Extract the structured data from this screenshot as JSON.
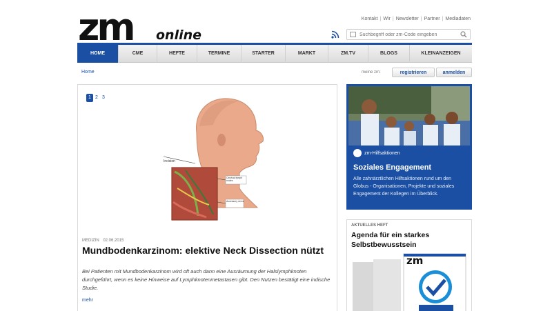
{
  "logo": {
    "zm": "zm",
    "online": "online"
  },
  "toplinks": [
    "Kontakt",
    "Wir",
    "Newsletter",
    "Partner",
    "Mediadaten"
  ],
  "search": {
    "placeholder": "Suchbegriff oder zm-Code eingeben"
  },
  "nav": {
    "items": [
      "HOME",
      "CME",
      "HEFTE",
      "TERMINE",
      "STARTER",
      "MARKT",
      "ZM.TV",
      "BLOGS",
      "KLEINANZEIGEN"
    ],
    "active": "HOME"
  },
  "breadcrumb": "Home",
  "account": {
    "meinzm": "meine zm:",
    "register": "registrieren",
    "login": "anmelden"
  },
  "article": {
    "pager": [
      "1",
      "2",
      "3"
    ],
    "category": "MEDIZIN",
    "date": "02.06.2015",
    "headline": "Mundbodenkarzinom: elektive Neck Dissection nützt",
    "teaser": "Bei Patienten mit Mundbodenkarzinom wird oft auch dann eine Ausräumung der Halslymphknoten durchgeführt, wenn es keine Hinweise auf Lymphknotenmetastasen gibt. Den Nutzen bestätigt eine indische Studie.",
    "more": "mehr",
    "illustration_labels": {
      "incision": "Incision",
      "lymph": "Cervical lymph nodes",
      "accessory": "Accessory nerve"
    }
  },
  "promo": {
    "brand": "zm-Hilfsaktionen",
    "title": "Soziales Engagement",
    "description": "Alle zahnärztlichen Hilfsaktionen rund um den Globus - Organisationen, Projekte und soziales Engagement der Kollegen im Überblick."
  },
  "heft": {
    "label": "AKTUELLES HEFT",
    "title": "Agenda für ein starkes Selbstbewusstsein",
    "cover_logo": "zm"
  },
  "colors": {
    "brand_blue": "#1a4fa3",
    "nav_bg": "#e6e6e6"
  }
}
